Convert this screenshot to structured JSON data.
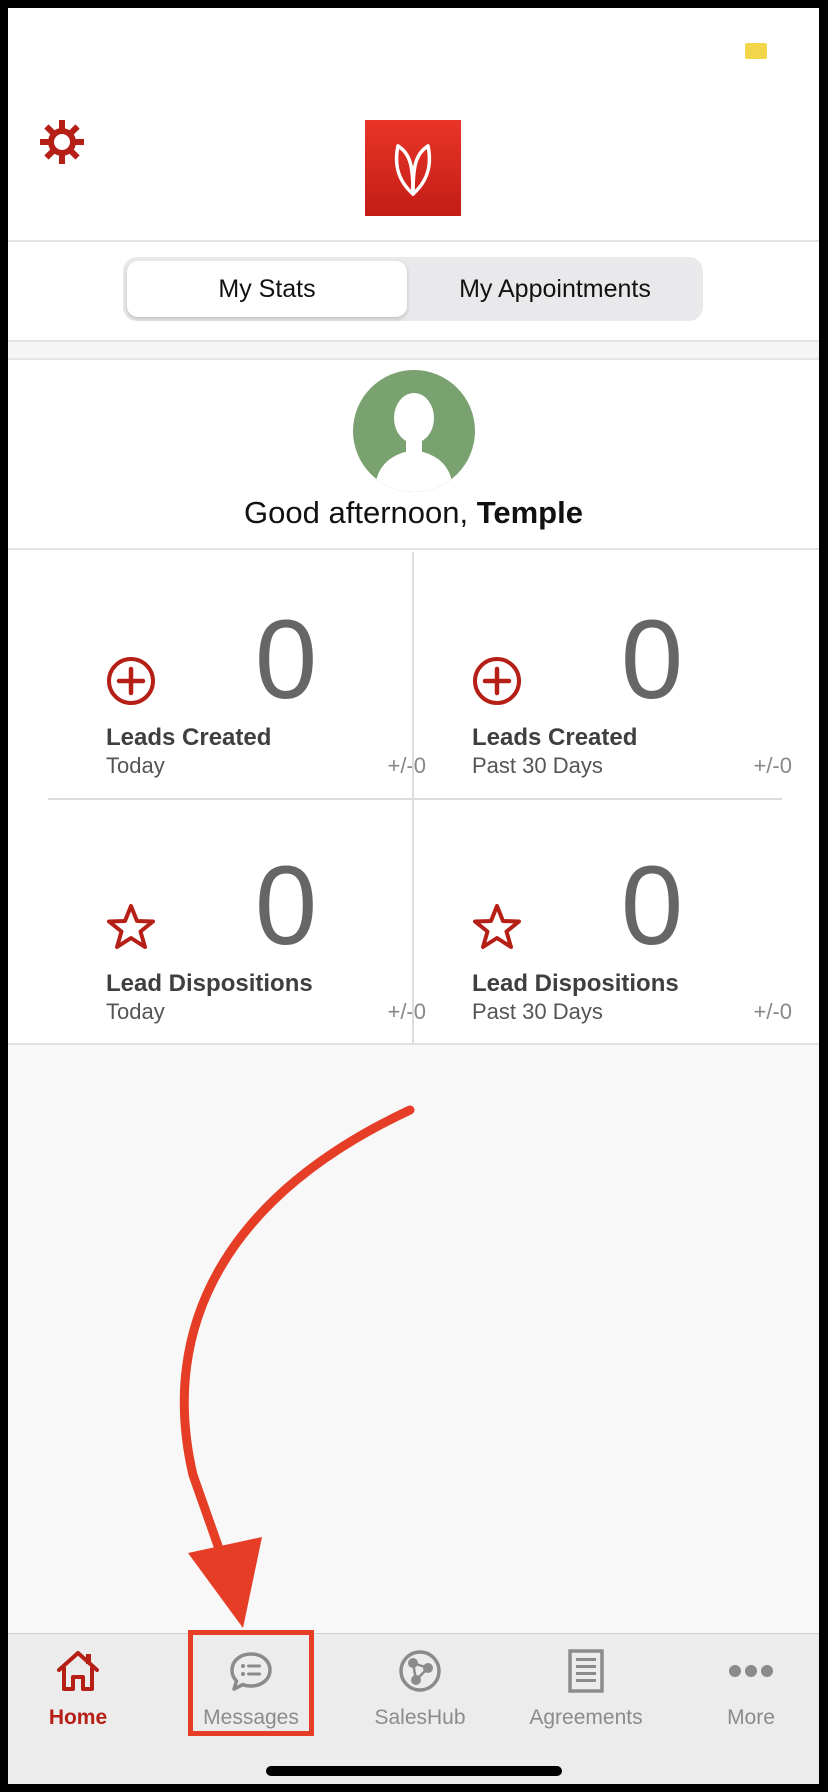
{
  "header": {
    "settings_icon": "gear-icon",
    "logo_icon": "brand-logo-icon",
    "accent_color": "#b51f16"
  },
  "segmented": {
    "tabs": [
      {
        "label": "My Stats",
        "active": true
      },
      {
        "label": "My Appointments",
        "active": false
      }
    ]
  },
  "profile": {
    "greeting_prefix": "Good afternoon, ",
    "name": "Temple"
  },
  "stats": [
    {
      "icon": "plus-circle-icon",
      "value": "0",
      "label": "Leads Created",
      "period": "Today",
      "delta": "+/-0"
    },
    {
      "icon": "plus-circle-icon",
      "value": "0",
      "label": "Leads Created",
      "period": "Past 30 Days",
      "delta": "+/-0"
    },
    {
      "icon": "star-icon",
      "value": "0",
      "label": "Lead Dispositions",
      "period": "Today",
      "delta": "+/-0"
    },
    {
      "icon": "star-icon",
      "value": "0",
      "label": "Lead Dispositions",
      "period": "Past 30 Days",
      "delta": "+/-0"
    }
  ],
  "tabbar": {
    "items": [
      {
        "label": "Home",
        "icon": "home-icon",
        "active": true
      },
      {
        "label": "Messages",
        "icon": "chat-bubble-icon",
        "active": false
      },
      {
        "label": "SalesHub",
        "icon": "globe-network-icon",
        "active": false
      },
      {
        "label": "Agreements",
        "icon": "document-icon",
        "active": false
      },
      {
        "label": "More",
        "icon": "more-dots-icon",
        "active": false
      }
    ]
  },
  "annotation": {
    "highlight_color": "#e53d26"
  }
}
